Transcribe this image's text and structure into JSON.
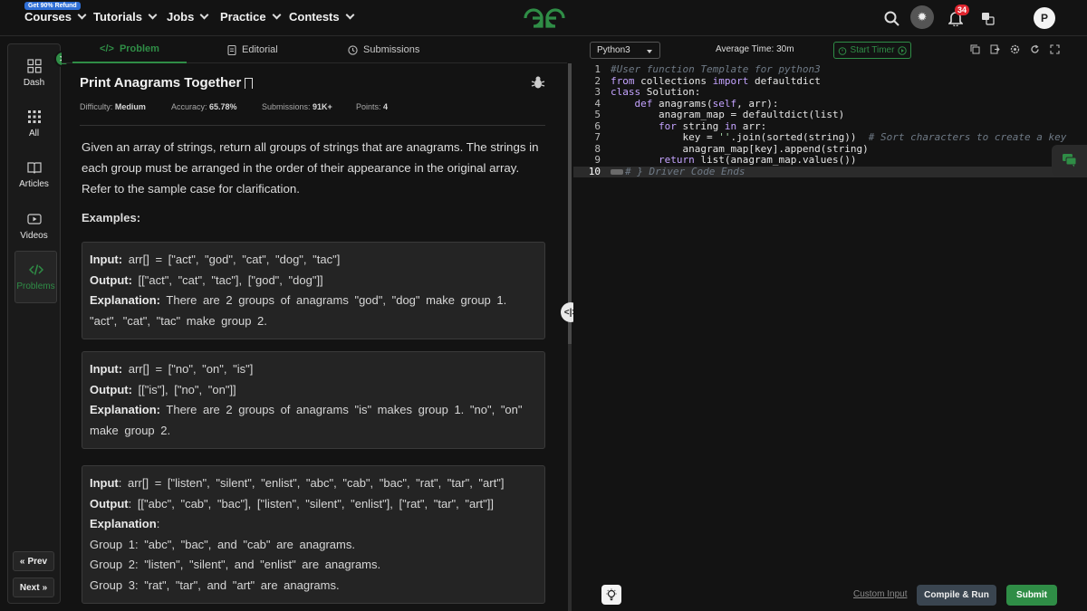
{
  "topbar": {
    "refund_badge": "Get 90% Refund",
    "nav": [
      "Courses",
      "Tutorials",
      "Jobs",
      "Practice",
      "Contests"
    ],
    "notification_count": "34",
    "avatar_initial": "P"
  },
  "sidebar": {
    "items": [
      "Dash",
      "All",
      "Articles",
      "Videos",
      "Problems"
    ],
    "prev": "Prev",
    "next": "Next"
  },
  "tabs": [
    "Problem",
    "Editorial",
    "Submissions"
  ],
  "problem": {
    "title": "Print Anagrams Together",
    "meta": {
      "difficulty_label": "Difficulty:",
      "difficulty": "Medium",
      "accuracy_label": "Accuracy:",
      "accuracy": "65.78%",
      "submissions_label": "Submissions:",
      "submissions": "91K+",
      "points_label": "Points:",
      "points": "4"
    },
    "description": "Given an array of strings, return all groups of strings that are anagrams. The strings in each group must be arranged in the order of their appearance in the original array. Refer to the sample case for clarification.",
    "examples_heading": "Examples:",
    "examples": [
      {
        "input_label": "Input:",
        "input": "arr[] = [\"act\", \"god\", \"cat\", \"dog\", \"tac\"]",
        "output_label": "Output:",
        "output": "[[\"act\", \"cat\", \"tac\"], [\"god\", \"dog\"]]",
        "explanation_label": "Explanation:",
        "explanation": "There are 2 groups of anagrams \"god\", \"dog\" make group 1. \"act\", \"cat\", \"tac\" make group 2."
      },
      {
        "input_label": "Input:",
        "input": "arr[] = [\"no\", \"on\", \"is\"]",
        "output_label": "Output:",
        "output": "[[\"is\"], [\"no\", \"on\"]]",
        "explanation_label": "Explanation:",
        "explanation": "There are 2 groups of anagrams \"is\" makes group 1. \"no\", \"on\" make group 2."
      },
      {
        "input_label": "Input",
        "input": ": arr[] = [\"listen\", \"silent\", \"enlist\", \"abc\", \"cab\", \"bac\", \"rat\", \"tar\", \"art\"]",
        "output_label": "Output",
        "output": ": [[\"abc\", \"cab\", \"bac\"], [\"listen\", \"silent\", \"enlist\"], [\"rat\", \"tar\", \"art\"]]",
        "explanation_label": "Explanation",
        "explanation": ":",
        "groups": [
          "Group 1: \"abc\", \"bac\", and \"cab\" are anagrams.",
          "Group 2: \"listen\", \"silent\", and \"enlist\" are anagrams.",
          "Group 3: \"rat\", \"tar\", and \"art\" are anagrams."
        ]
      }
    ]
  },
  "editor": {
    "language": "Python3",
    "average_time": "Average Time: 30m",
    "start_timer": "Start Timer",
    "line_numbers": [
      "1",
      "2",
      "3",
      "4",
      "5",
      "6",
      "7",
      "8",
      "9",
      "10"
    ],
    "code": {
      "l1_comment": "#User function Template for python3",
      "l2_from": "from",
      "l2_mod": " collections ",
      "l2_import": "import",
      "l2_name": " defaultdict",
      "l3_class": "class",
      "l3_name": " Solution:",
      "l4_indent": "    ",
      "l4_def": "def",
      "l4_sig": " anagrams(",
      "l4_self": "self",
      "l4_rest": ", arr):",
      "l5": "        anagram_map = defaultdict(list)",
      "l6_indent": "        ",
      "l6_for": "for",
      "l6_mid": " string ",
      "l6_in": "in",
      "l6_rest": " arr:",
      "l7_code": "            key = ",
      "l7_str": "''",
      "l7_rest": ".join(sorted(string))  ",
      "l7_comment": "# Sort characters to create a key",
      "l8": "            anagram_map[key].append(string)",
      "l9_indent": "        ",
      "l9_return": "return",
      "l9_rest": " list(anagram_map.values())",
      "l10_comment": "# } Driver Code Ends"
    },
    "custom_input": "Custom Input",
    "compile_run": "Compile & Run",
    "submit": "Submit"
  },
  "colors": {
    "accent": "#2f8d46",
    "background": "#131313",
    "panel": "#242424"
  }
}
